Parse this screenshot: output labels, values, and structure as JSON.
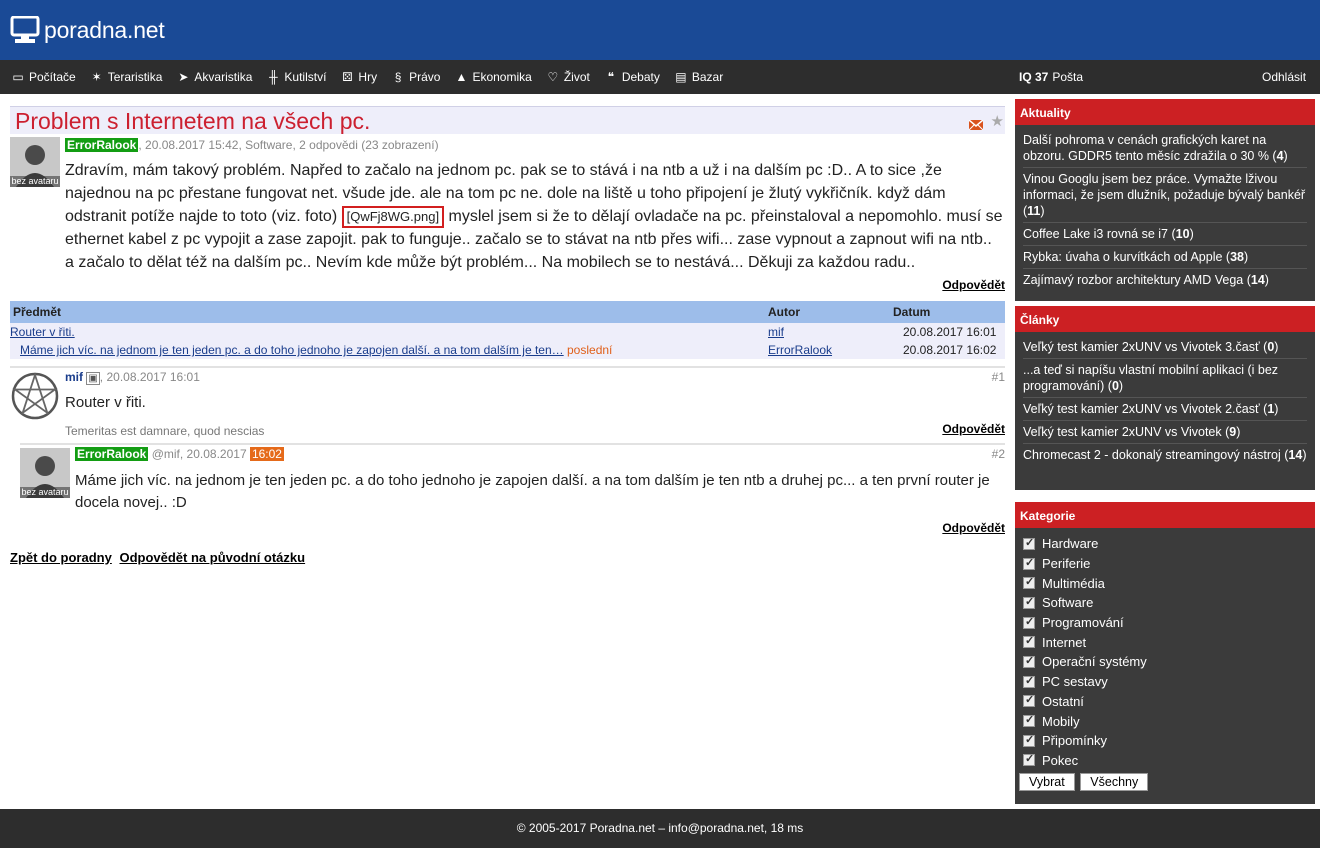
{
  "site": {
    "name": "poradna.net"
  },
  "nav": {
    "items": [
      {
        "label": "Počítače",
        "icon": "computer-icon"
      },
      {
        "label": "Teraristika",
        "icon": "lizard-icon"
      },
      {
        "label": "Akvaristika",
        "icon": "fish-icon"
      },
      {
        "label": "Kutilství",
        "icon": "tools-icon"
      },
      {
        "label": "Hry",
        "icon": "dice-icon"
      },
      {
        "label": "Právo",
        "icon": "paragraph-icon"
      },
      {
        "label": "Ekonomika",
        "icon": "chart-icon"
      },
      {
        "label": "Život",
        "icon": "heart-icon"
      },
      {
        "label": "Debaty",
        "icon": "speech-icon"
      },
      {
        "label": "Bazar",
        "icon": "cart-icon"
      }
    ],
    "iq": "IQ 37",
    "mail": "Pošta",
    "logout": "Odhlásit"
  },
  "question": {
    "title": "Problem s Internetem na všech pc.",
    "author": "ErrorRalook",
    "meta": ", 20.08.2017 15:42, Software, 2 odpovědi (23 zobrazení)",
    "avatar_label": "bez avataru",
    "text_before": "Zdravím, mám takový problém. Napřed to začalo na jednom pc. pak se to stává i na ntb a už i na dalším pc :D.. A to sice ,že najednou na pc přestane fungovat net. všude jde. ale na tom pc ne. dole na liště u toho připojení je žlutý vykřičník. když dám odstranit potíže najde to toto (viz. foto) ",
    "attachment": "[QwFj8WG.png]",
    "text_after": " myslel jsem si že to dělají ovladače na pc. přeinstaloval a nepomohlo. musí se ethernet kabel z pc vypojit a zase zapojit. pak to funguje.. začalo se to stávat na ntb přes wifi... zase vypnout a zapnout wifi na ntb.. a začalo to dělat též na dalším pc.. Nevím kde může být problém... Na mobilech se to nestává... Děkuji za každou radu..",
    "reply_label": "Odpovědět"
  },
  "thread": {
    "headers": {
      "subject": "Předmět",
      "author": "Autor",
      "date": "Datum"
    },
    "rows": [
      {
        "subject": "Router v řiti.",
        "author": "mif",
        "date": "20.08.2017 16:01"
      },
      {
        "subject": "Máme jich víc. na jednom je ten jeden pc. a do toho jednoho je zapojen další. a na tom dalším je ten…",
        "tag": "poslední",
        "author": "ErrorRalook",
        "date": "20.08.2017 16:02"
      }
    ]
  },
  "posts": [
    {
      "user": "mif",
      "meta": ", 20.08.2017 16:01",
      "num": "#1",
      "text": "Router v řiti.",
      "signature": "Temeritas est damnare, quod nescias",
      "reply_label": "Odpovědět"
    },
    {
      "user": "ErrorRalook",
      "mention": "@mif",
      "meta": ", 20.08.2017 ",
      "time": "16:02",
      "num": "#2",
      "avatar_label": "bez avataru",
      "text": "Máme jich víc. na jednom je ten jeden pc. a do toho jednoho je zapojen další. a na tom dalším je ten ntb a druhej pc... a ten první router je docela novej.. :D",
      "reply_label": "Odpovědět"
    }
  ],
  "bottom": {
    "back": "Zpět do poradny",
    "reply_original": "Odpovědět na původní otázku"
  },
  "sidebar": {
    "news": {
      "title": "Aktuality",
      "items": [
        {
          "text": "Další pohroma v cenách grafických karet na obzoru. GDDR5 tento měsíc zdražila o 30 %",
          "count": "4"
        },
        {
          "text": "Vinou Googlu jsem bez práce. Vymažte lživou informaci, že jsem dlužník, požaduje bývalý bankéř",
          "count": "11"
        },
        {
          "text": "Coffee Lake i3 rovná se i7",
          "count": "10"
        },
        {
          "text": "Rybka: úvaha o kurvítkách od Apple",
          "count": "38"
        },
        {
          "text": "Zajímavý rozbor architektury AMD Vega",
          "count": "14"
        }
      ]
    },
    "articles": {
      "title": "Články",
      "items": [
        {
          "text": "Veľký test kamier 2xUNV vs Vivotek 3.časť",
          "count": "0"
        },
        {
          "text": "...a teď si napíšu vlastní mobilní aplikaci (i bez programování)",
          "count": "0"
        },
        {
          "text": "Veľký test kamier 2xUNV vs Vivotek 2.časť",
          "count": "1"
        },
        {
          "text": "Veľký test kamier 2xUNV vs Vivotek",
          "count": "9"
        },
        {
          "text": "Chromecast 2 - dokonalý streamingový nástroj",
          "count": "14"
        }
      ]
    },
    "categories": {
      "title": "Kategorie",
      "items": [
        "Hardware",
        "Periferie",
        "Multimédia",
        "Software",
        "Programování",
        "Internet",
        "Operační systémy",
        "PC sestavy",
        "Ostatní",
        "Mobily",
        "Připomínky",
        "Pokec"
      ],
      "select_label": "Vybrat",
      "all_label": "Všechny"
    }
  },
  "footer": {
    "text": "© 2005-2017 Poradna.net – info@poradna.net, 18 ms"
  }
}
